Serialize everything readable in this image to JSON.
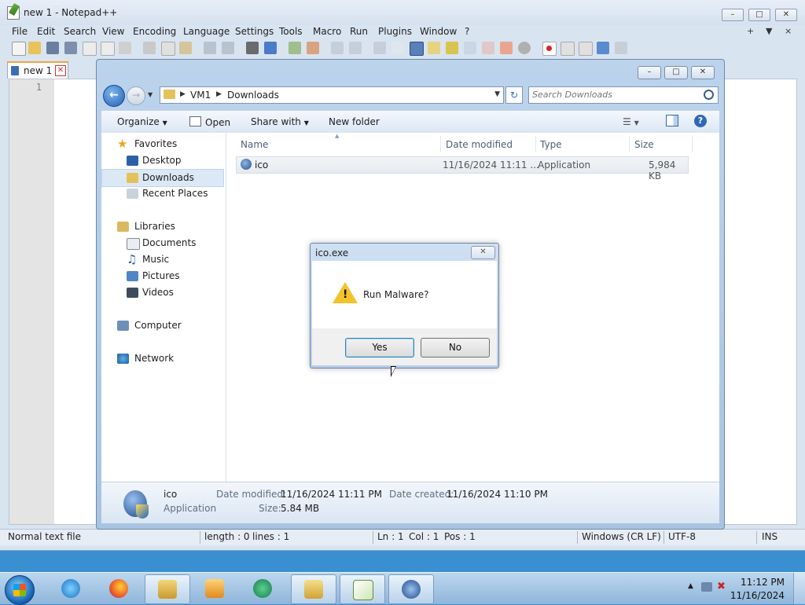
{
  "notepad": {
    "title": "new 1 - Notepad++",
    "menu": [
      "File",
      "Edit",
      "Search",
      "View",
      "Encoding",
      "Language",
      "Settings",
      "Tools",
      "Macro",
      "Run",
      "Plugins",
      "Window",
      "?"
    ],
    "menu_right": [
      "+",
      "▼",
      "×"
    ],
    "tab_label": "new 1",
    "line_number": "1",
    "status": {
      "type": "Normal text file",
      "length": "length : 0",
      "lines": "lines : 1",
      "ln": "Ln : 1",
      "col": "Col : 1",
      "pos": "Pos : 1",
      "eol": "Windows (CR LF)",
      "encoding": "UTF-8",
      "mode": "INS"
    }
  },
  "explorer": {
    "breadcrumb": [
      "VM1",
      "Downloads"
    ],
    "search_placeholder": "Search Downloads",
    "commands": {
      "organize": "Organize",
      "open": "Open",
      "share_with": "Share with",
      "new_folder": "New folder"
    },
    "nav": {
      "favorites": "Favorites",
      "desktop": "Desktop",
      "downloads": "Downloads",
      "recent_places": "Recent Places",
      "libraries": "Libraries",
      "documents": "Documents",
      "music": "Music",
      "pictures": "Pictures",
      "videos": "Videos",
      "computer": "Computer",
      "network": "Network"
    },
    "columns": {
      "name": "Name",
      "date_modified": "Date modified",
      "type": "Type",
      "size": "Size"
    },
    "files": [
      {
        "name": "ico",
        "date_modified": "11/16/2024 11:11 ...",
        "type": "Application",
        "size": "5,984 KB"
      }
    ],
    "details": {
      "name": "ico",
      "type": "Application",
      "date_modified_label": "Date modified:",
      "date_modified": "11/16/2024 11:11 PM",
      "size_label": "Size:",
      "size": "5.84 MB",
      "date_created_label": "Date created:",
      "date_created": "11/16/2024 11:10 PM"
    }
  },
  "dialog": {
    "title": "ico.exe",
    "message": "Run Malware?",
    "yes": "Yes",
    "no": "No",
    "icon": "warning-icon"
  },
  "taskbar": {
    "apps": [
      "internet-explorer",
      "firefox",
      "windows-explorer",
      "media-player",
      "edge-like-app",
      "downloads-explorer",
      "notepad-plus-plus",
      "ico-app"
    ],
    "time": "11:12 PM",
    "date": "11/16/2024"
  },
  "colors": {
    "accent": "#3c7fb1",
    "warning": "#f4c22a",
    "taskbar": "#8fb5da"
  }
}
